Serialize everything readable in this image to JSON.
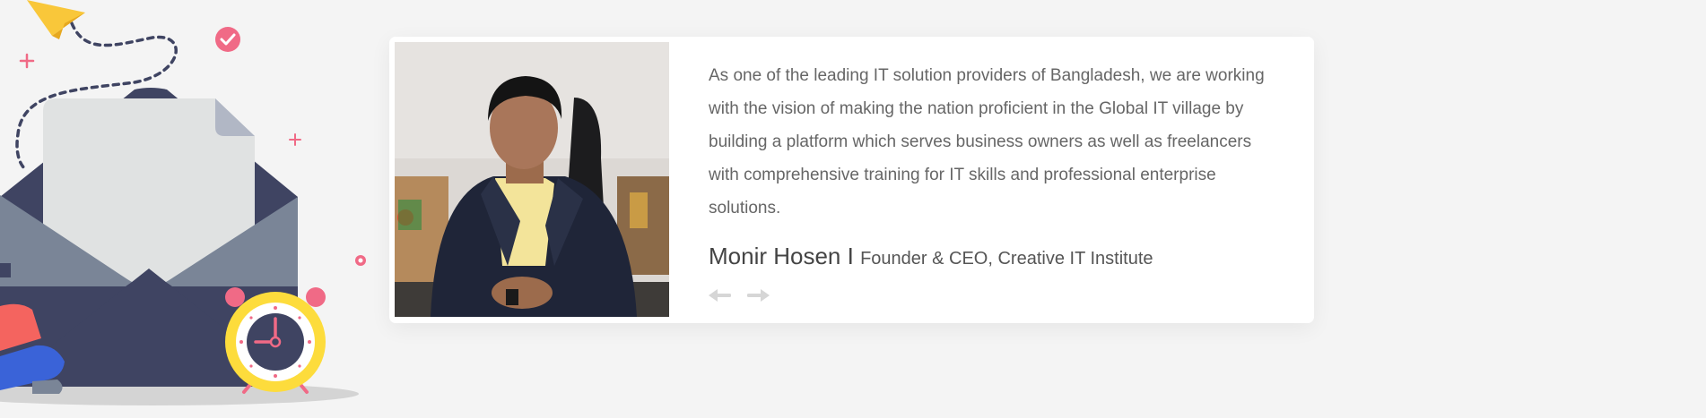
{
  "testimonial": {
    "quote": "As one of the leading IT solution providers of Bangladesh, we are working with the vision of making the nation proficient in the Global IT village by building a platform which serves business owners as well as freelancers with comprehensive training for IT skills and professional enterprise solutions.",
    "author_name": "Monir Hosen I",
    "author_role": "Founder & CEO, Creative IT Institute"
  },
  "navigation": {
    "prev_icon": "arrow-left-icon",
    "next_icon": "arrow-right-icon"
  },
  "illustration": {
    "icons": [
      "paper-plane-icon",
      "check-badge-icon",
      "envelope-icon",
      "document-icon",
      "alarm-clock-icon",
      "person-icon"
    ]
  },
  "colors": {
    "background": "#f4f4f4",
    "card": "#ffffff",
    "text": "#666666",
    "envelope_dark": "#3f4462",
    "envelope_mid": "#7a8597",
    "clock_yellow": "#fddc3c",
    "accent_pink": "#f06a86",
    "plane_yellow": "#f9c73a"
  }
}
